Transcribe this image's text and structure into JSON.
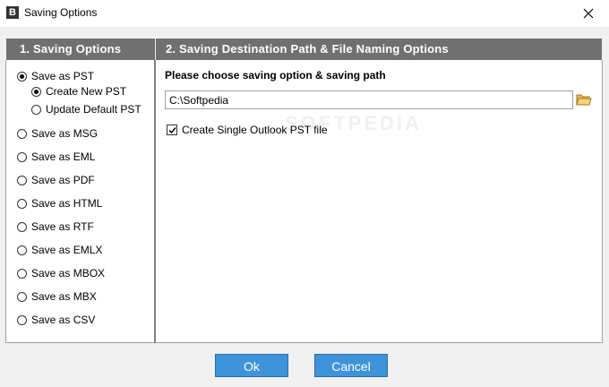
{
  "window": {
    "title": "Saving Options",
    "app_icon_letter": "B",
    "close_icon": "close-icon"
  },
  "left_panel": {
    "header": "1. Saving Options",
    "options": [
      {
        "label": "Save as PST",
        "checked": true
      },
      {
        "label": "Create New PST",
        "checked": true
      },
      {
        "label": "Update Default PST",
        "checked": false
      },
      {
        "label": "Save as MSG",
        "checked": false
      },
      {
        "label": "Save as EML",
        "checked": false
      },
      {
        "label": "Save as PDF",
        "checked": false
      },
      {
        "label": "Save as HTML",
        "checked": false
      },
      {
        "label": "Save as RTF",
        "checked": false
      },
      {
        "label": "Save as EMLX",
        "checked": false
      },
      {
        "label": "Save as MBOX",
        "checked": false
      },
      {
        "label": "Save as MBX",
        "checked": false
      },
      {
        "label": "Save as CSV",
        "checked": false
      }
    ]
  },
  "right_panel": {
    "header": "2. Saving Destination Path & File Naming Options",
    "prompt": "Please choose saving option & saving path",
    "path_value": "C:\\Softpedia",
    "browse_icon": "folder-icon",
    "single_pst_label": "Create Single Outlook PST file",
    "single_pst_checked": true,
    "watermark": "SOFTPEDIA"
  },
  "buttons": {
    "ok": "Ok",
    "cancel": "Cancel"
  },
  "colors": {
    "header_bg": "#707070",
    "button_bg": "#3f93d9"
  }
}
